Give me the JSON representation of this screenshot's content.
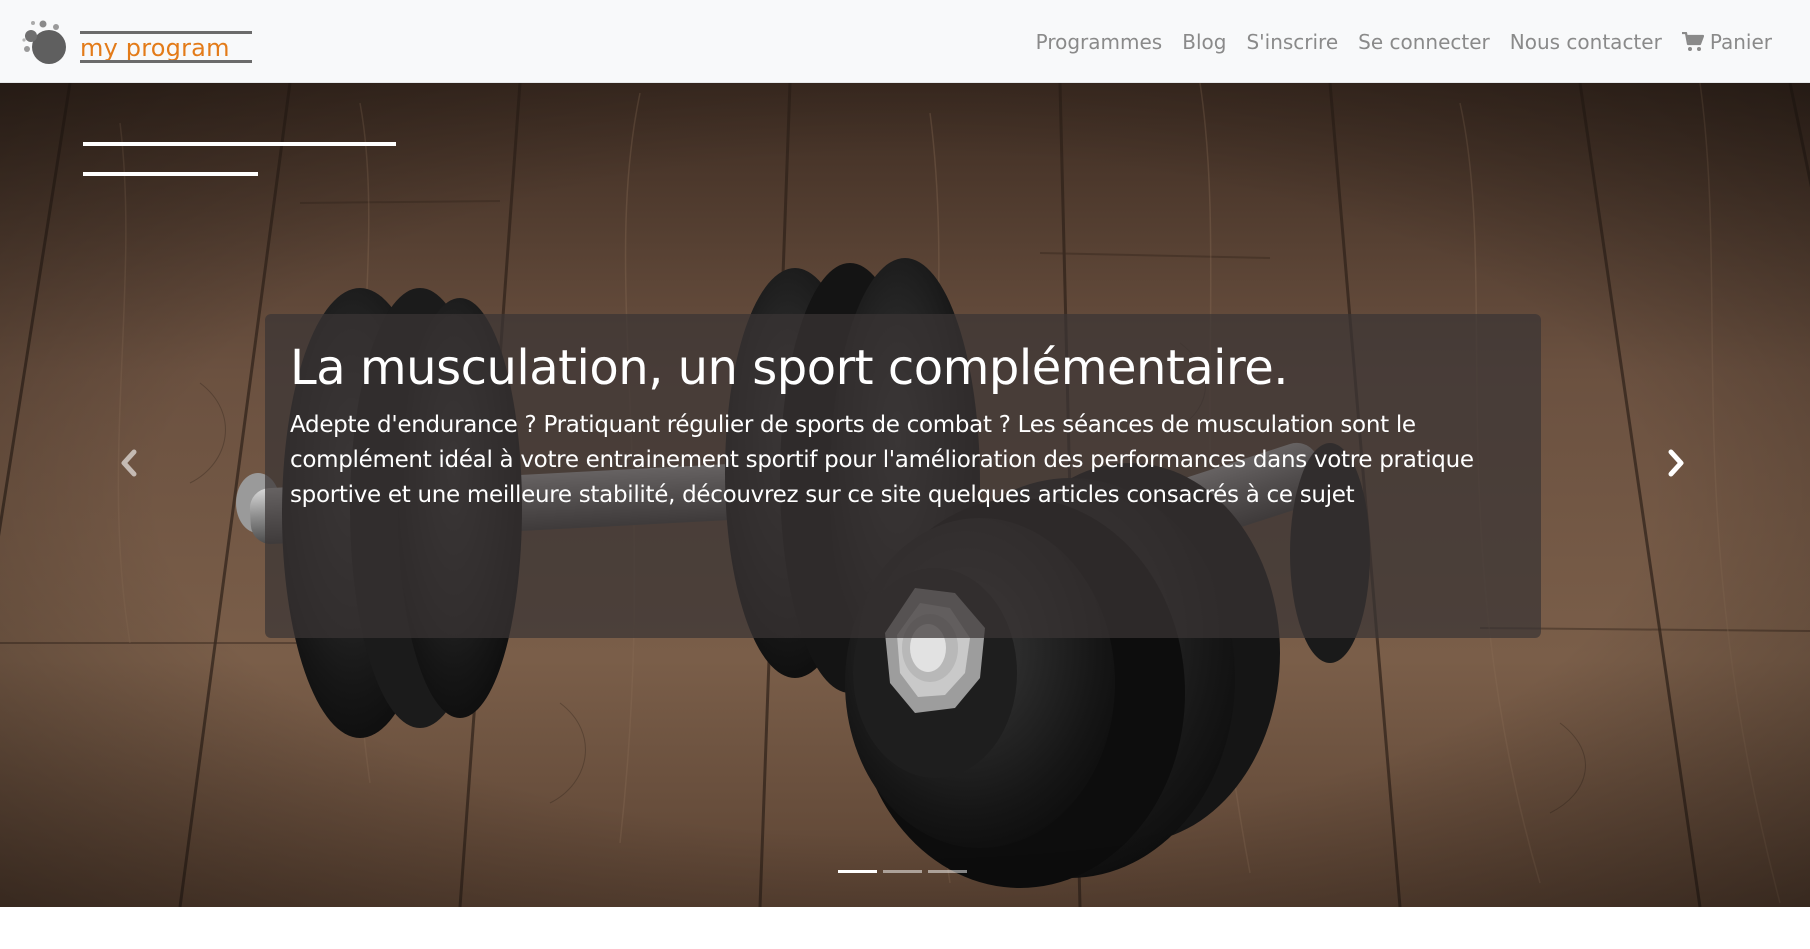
{
  "brand": {
    "name": "my program",
    "accent_color": "#e37b19",
    "logo_icon": "dots-circle-logo-icon"
  },
  "nav": {
    "items": [
      {
        "label": "Programmes"
      },
      {
        "label": "Blog"
      },
      {
        "label": "S'inscrire"
      },
      {
        "label": "Se connecter"
      },
      {
        "label": "Nous contacter"
      },
      {
        "label": "Panier",
        "icon": "shopping-cart-icon"
      }
    ]
  },
  "carousel": {
    "background": "dumbbells-on-wooden-floor",
    "slide_count": 3,
    "active_index": 0,
    "caption": {
      "title": "La musculation, un sport complémentaire.",
      "text": "Adepte d'endurance ? Pratiquant régulier de sports de combat ? Les séances de musculation sont le complément idéal à votre entrainement sportif pour l'amélioration des performances dans votre pratique sportive et une meilleure stabilité, découvrez sur ce site quelques articles consacrés à ce sujet"
    },
    "controls": {
      "prev_icon": "chevron-left-icon",
      "next_icon": "chevron-right-icon"
    }
  }
}
